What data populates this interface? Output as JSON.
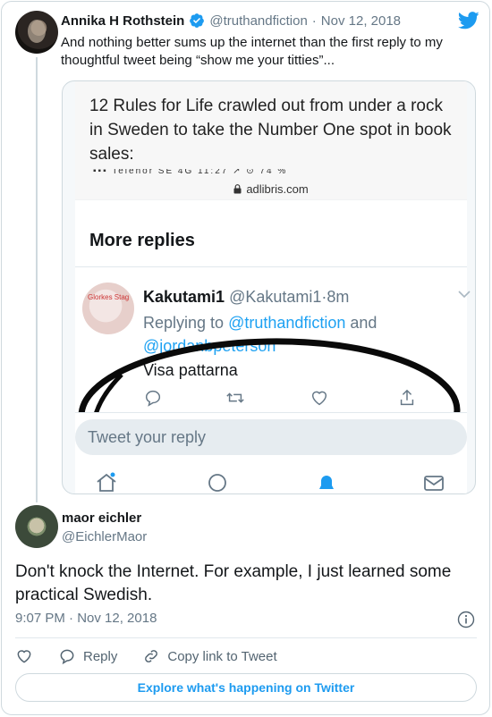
{
  "parent_tweet": {
    "author_name": "Annika H Rothstein",
    "handle": "@truthandfiction",
    "separator": "·",
    "date": "Nov 12, 2018",
    "text": "And nothing better sums up the internet than the first reply to my thoughtful tweet being “show me your titties”...",
    "verified": true
  },
  "embedded_screenshot": {
    "snippet_text": "12 Rules for Life crawled out from under a rock in Sweden to take the Number One spot in book sales:",
    "status_bar": "▪▪▪ Telenor SE  4G         11:27        ↗ ⊙ 74 %",
    "url": "adlibris.com",
    "section_title": "More replies",
    "reply": {
      "avatar_text": "Glorkes Stag",
      "name": "Kakutami1",
      "handle": "@Kakutami1",
      "separator": "·",
      "age": "8m",
      "replying_prefix": "Replying to ",
      "mention_1": "@truthandfiction",
      "connector": " and ",
      "mention_2": "@jordanbpeterson",
      "text": "Visa pattarna"
    },
    "reply_placeholder": "Tweet your reply"
  },
  "main_tweet": {
    "author_name": "maor eichler",
    "handle": "@EichlerMaor",
    "text": "Don't knock the Internet. For example, I just learned some practical Swedish.",
    "timestamp": "9:07 PM · Nov 12, 2018"
  },
  "actions": {
    "reply_label": "Reply",
    "copy_link_label": "Copy link to Tweet"
  },
  "explore_button": "Explore what's happening on Twitter",
  "colors": {
    "twitter_blue": "#1d9bf0",
    "text": "#14171a",
    "muted": "#657786",
    "border": "#cfd9de"
  }
}
